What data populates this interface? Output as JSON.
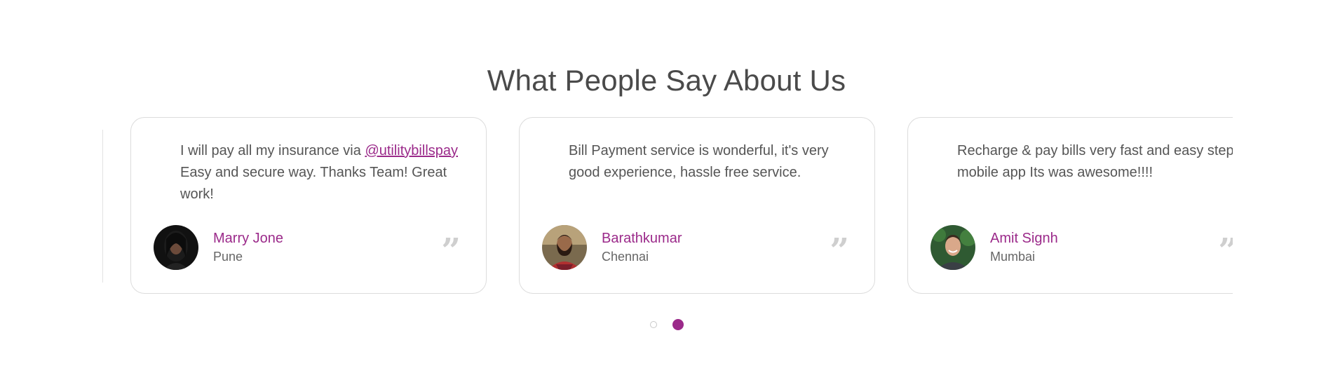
{
  "section": {
    "title": "What People Say About Us"
  },
  "testimonials": [
    {
      "text_before": "I will pay all my insurance via ",
      "mention": "@utilitybillspay",
      "text_after": " Easy and secure way. Thanks Team! Great work!",
      "name": "Marry Jone",
      "city": "Pune",
      "avatar": "woman-dark-hair-avatar"
    },
    {
      "text": "Bill Payment service is wonderful, it's very good experience, hassle free service.",
      "name": "Barathkumar",
      "city": "Chennai",
      "avatar": "man-beard-red-shirt-avatar"
    },
    {
      "text": "Recharge & pay bills very fast and easy steps on mobile app Its was awesome!!!!",
      "name": "Amit Signh",
      "city": "Mumbai",
      "avatar": "man-smiling-green-background-avatar"
    }
  ],
  "quote_icon": "”",
  "pagination": {
    "pages": 2,
    "active_page": 2
  },
  "colors": {
    "accent": "#9b2a8a",
    "heading": "#4a4a4a",
    "body_text": "#555555",
    "card_border": "#dcdcdc",
    "quote_icon": "#cfcfcf"
  }
}
